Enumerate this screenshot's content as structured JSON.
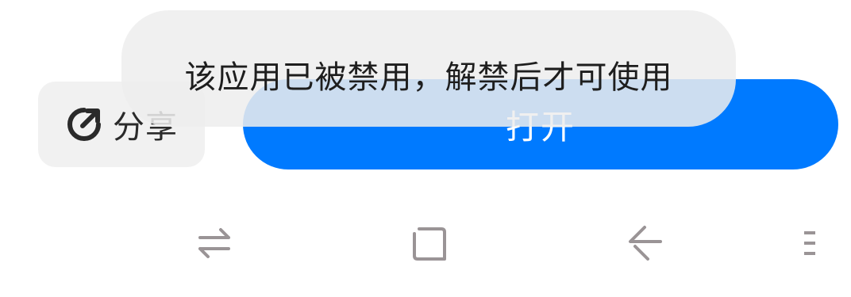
{
  "toast": {
    "message": "该应用已被禁用，解禁后才可使用"
  },
  "share_button": {
    "label": "分享",
    "icon": "share-icon"
  },
  "open_button": {
    "label": "打开"
  },
  "navigation_bar": {
    "items": [
      {
        "icon": "switch-apps-icon"
      },
      {
        "icon": "home-square-icon"
      },
      {
        "icon": "back-arrow-icon"
      },
      {
        "icon": "menu-lines-icon"
      }
    ]
  },
  "colors": {
    "accent": "#007aff",
    "toast_background": "#eeeeee",
    "share_background": "#f1f1f1",
    "nav_icon": "#9a9496"
  }
}
